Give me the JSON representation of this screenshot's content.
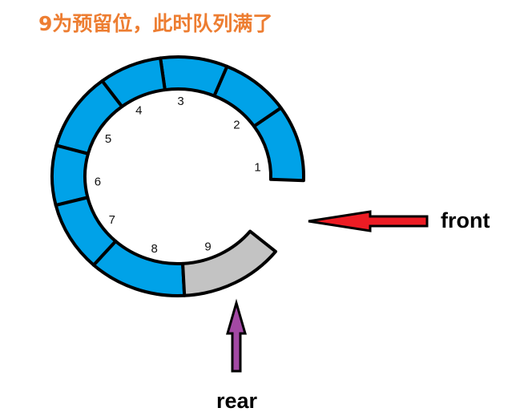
{
  "title": "9为预留位，此时队列满了",
  "queue": {
    "slots": [
      {
        "label": "1",
        "state": "filled"
      },
      {
        "label": "2",
        "state": "filled"
      },
      {
        "label": "3",
        "state": "filled"
      },
      {
        "label": "4",
        "state": "filled"
      },
      {
        "label": "5",
        "state": "filled"
      },
      {
        "label": "6",
        "state": "filled"
      },
      {
        "label": "7",
        "state": "filled"
      },
      {
        "label": "8",
        "state": "filled"
      },
      {
        "label": "9",
        "state": "reserved"
      }
    ],
    "front_label": "front",
    "rear_label": "rear"
  },
  "colors": {
    "title": "#ED7D31",
    "filled": "#00A2E8",
    "reserved": "#C3C3C3",
    "outline": "#000000",
    "front_arrow": "#ED1C24",
    "rear_arrow": "#A349A4"
  }
}
